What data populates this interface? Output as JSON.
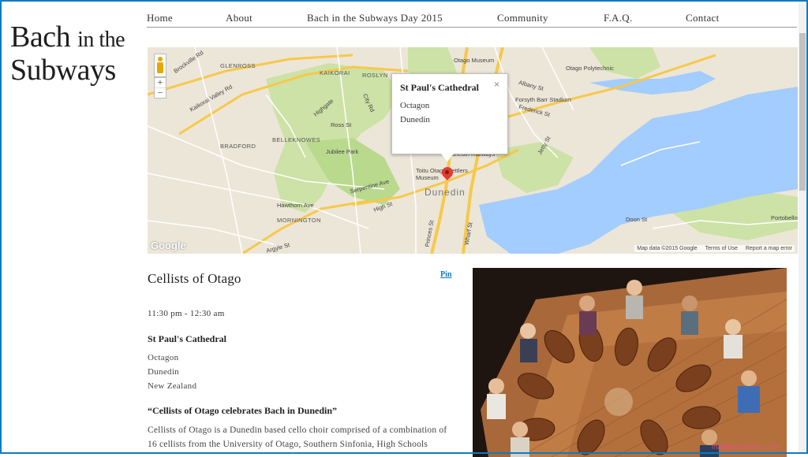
{
  "site": {
    "logo_line1": "Bach",
    "logo_line1b": "in the",
    "logo_line2": "Subways"
  },
  "nav": {
    "items": [
      {
        "label": "Home"
      },
      {
        "label": "About"
      },
      {
        "label": "Bach in the Subways Day 2015"
      },
      {
        "label": "Community"
      },
      {
        "label": "F.A.Q."
      },
      {
        "label": "Contact"
      }
    ]
  },
  "map": {
    "info_title": "St Paul's Cathedral",
    "info_line1": "Octagon",
    "info_line2": "Dunedin",
    "close_symbol": "×",
    "zoom_in": "+",
    "zoom_out": "−",
    "google_text": "Google",
    "footer_data": "Map data ©2015 Google",
    "footer_terms": "Terms of Use",
    "footer_report": "Report a map error",
    "labels": {
      "city": "Dunedin",
      "otago_museum": "Otago Museum",
      "otago_polytechnic": "Otago Polytechnic",
      "forsyth_barr": "Forsyth Barr Stadium",
      "glenross": "GLENROSS",
      "kaikorai": "KAIKORAI",
      "roslyn": "ROSLYN",
      "belleknowes": "BELLEKNOWES",
      "bradford": "BRADFORD",
      "mornington": "MORNINGTON",
      "jubilee_park": "Jubilee Park",
      "kaikorai_valley_rd": "Kaikorai Valley Rd",
      "brockville_rd": "Brockville Rd",
      "highgate": "Highgate",
      "ross_st": "Ross St",
      "city_rd": "City Rd",
      "serpentine_ave": "Serpentine Ave",
      "hawthorn_ave": "Hawthorn Ave",
      "high_st": "High St",
      "argyle_st": "Argyle St",
      "princes_st": "Princes St",
      "wharf_st": "Wharf St",
      "albany_st": "Albany St",
      "frederick_st": "Frederick St",
      "jetty_st": "Jetty St",
      "toitu": "Toitu Otago Settlers Museum",
      "railways": "Dunedin Railways",
      "portobello": "Portobello",
      "doon_st": "Doon St"
    }
  },
  "event": {
    "title": "Cellists of Otago",
    "pin_label": "Pin",
    "time": "11:30 pm - 12:30 am",
    "venue": "St Paul's Cathedral",
    "address": [
      "Octagon",
      "Dunedin",
      "New Zealand"
    ],
    "quote": "“Cellists of Otago celebrates Bach in Dunedin”",
    "description": "Cellists of Otago is a Dunedin based cello choir comprised of a combination of 16 cellists from the University of Otago, Southern Sinfonia, High Schools"
  },
  "photo": {
    "credit": "matthewswaminathan"
  },
  "colors": {
    "accent": "#0d7bbf",
    "water": "#a3ccff",
    "park": "#c8df9e",
    "road": "#fcd66b",
    "marker": "#e53a30"
  }
}
